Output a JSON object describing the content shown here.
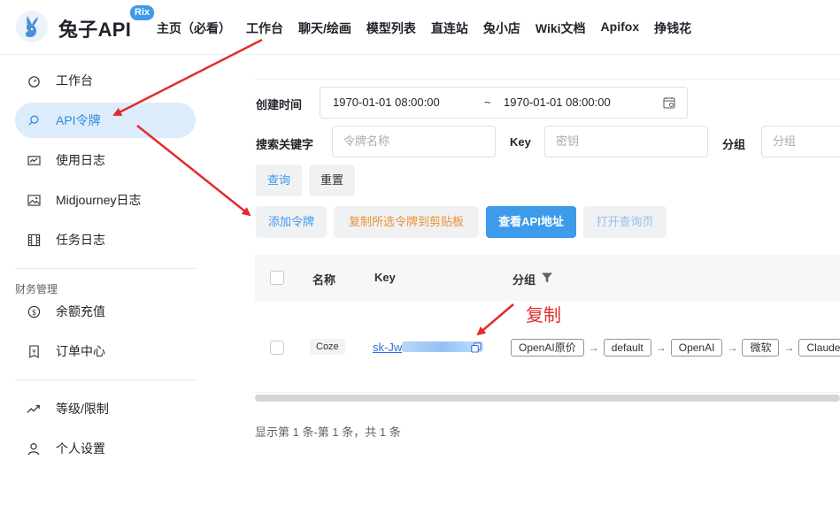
{
  "header": {
    "brand": "兔子API",
    "badge": "Rix",
    "nav": [
      "主页（必看）",
      "工作台",
      "聊天/绘画",
      "模型列表",
      "直连站",
      "兔小店",
      "Wiki文档",
      "Apifox",
      "挣钱花"
    ]
  },
  "sidebar": {
    "items": [
      {
        "label": "工作台",
        "icon": "dashboard-icon"
      },
      {
        "label": "API令牌",
        "icon": "search-icon",
        "active": true
      },
      {
        "label": "使用日志",
        "icon": "log-icon"
      },
      {
        "label": "Midjourney日志",
        "icon": "image-icon"
      },
      {
        "label": "任务日志",
        "icon": "film-icon"
      }
    ],
    "finance_section": "财务管理",
    "finance_items": [
      {
        "label": "余额充值",
        "icon": "dollar-icon"
      },
      {
        "label": "订单中心",
        "icon": "receipt-icon"
      }
    ],
    "bottom_items": [
      {
        "label": "等级/限制",
        "icon": "trend-icon"
      },
      {
        "label": "个人设置",
        "icon": "user-icon"
      }
    ]
  },
  "filters": {
    "created_label": "创建时间",
    "start_time": "1970-01-01 08:00:00",
    "range_sep": "~",
    "end_time": "1970-01-01 08:00:00",
    "keyword_label": "搜索关键字",
    "name_placeholder": "令牌名称",
    "key_label": "Key",
    "key_placeholder": "密钥",
    "group_label": "分组",
    "group_placeholder": "分组"
  },
  "actions": {
    "query": "查询",
    "reset": "重置",
    "add": "添加令牌",
    "copy_selected": "复制所选令牌到剪贴板",
    "view_api": "查看API地址",
    "open_query": "打开查询页"
  },
  "table": {
    "columns": [
      "名称",
      "Key",
      "分组"
    ],
    "rows": [
      {
        "name": "Coze",
        "key_prefix": "sk-Jw",
        "groups": [
          "OpenAI原价",
          "default",
          "OpenAI",
          "微软",
          "Claude"
        ]
      }
    ]
  },
  "pagination": "显示第 1 条-第 1 条，共 1 条",
  "annotation": "复制",
  "colors": {
    "accent": "#3d9bea",
    "annotation": "#e32c2c",
    "orange": "#e99235"
  }
}
